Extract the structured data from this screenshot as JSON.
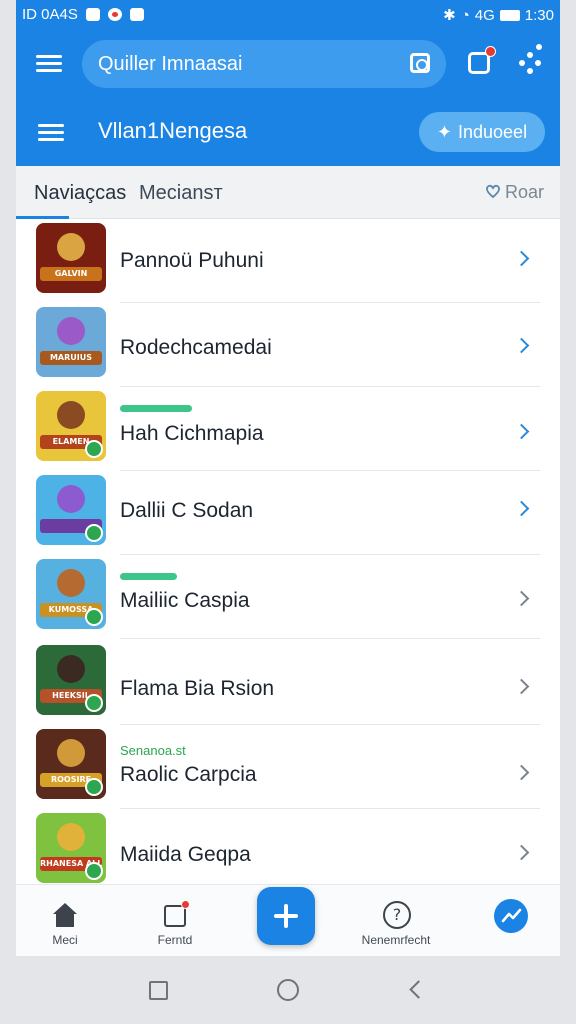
{
  "status_bar": {
    "time_left": "ID 0A4S",
    "time_right": "1:30",
    "signal_text": "4G"
  },
  "search": {
    "placeholder": "Quiller Imnaasai"
  },
  "header": {
    "title": "Vllan1Nengesa",
    "action_label": "Induoeel",
    "action_icon": "sparkle-icon"
  },
  "tabs": {
    "items": [
      "Naviaçcas",
      "Meciansт"
    ],
    "active": 0,
    "favorite_label": "Roar"
  },
  "list": [
    {
      "label": "Pannoü Puhuni",
      "thumb_text": "GALVIN",
      "bar": false,
      "sub": "",
      "chevron_color": "#2b8ad8",
      "thumb_bg": "#7a1e12",
      "face": "#d9a441",
      "banner": "#c8731c"
    },
    {
      "label": "Rodechcamedai",
      "thumb_text": "MARUIUS",
      "bar": false,
      "sub": "",
      "chevron_color": "#2b8ad8",
      "thumb_bg": "#6aa9d8",
      "face": "#9a5ac8",
      "banner": "#a8591e"
    },
    {
      "label": "Hah Cichmapia",
      "thumb_text": "ELAMEN",
      "bar": true,
      "sub": "",
      "chevron_color": "#2b8ad8",
      "thumb_bg": "#e8c53a",
      "face": "#8a4a22",
      "banner": "#b2431d"
    },
    {
      "label": "Dallii C Sodan",
      "thumb_text": "",
      "bar": false,
      "sub": "",
      "chevron_color": "#2b8ad8",
      "thumb_bg": "#4db2e6",
      "face": "#8c5bd0",
      "banner": "#6c3da0"
    },
    {
      "label": "Mailiic Caspia",
      "thumb_text": "KUMOSSA",
      "bar": true,
      "sub": "",
      "chevron_color": "#7a838c",
      "thumb_bg": "#57b1e0",
      "face": "#b56a32",
      "banner": "#c99022"
    },
    {
      "label": "Flama Bia Rsion",
      "thumb_text": "HEEKSIL",
      "bar": false,
      "sub": "",
      "chevron_color": "#7a838c",
      "thumb_bg": "#2d6a3a",
      "face": "#3a2a22",
      "banner": "#b5522a"
    },
    {
      "label": "Raolic Carpcia",
      "thumb_text": "ROOSIRE",
      "bar": false,
      "sub": "Senanoa.st",
      "chevron_color": "#7a838c",
      "thumb_bg": "#5a2a1c",
      "face": "#d09a3a",
      "banner": "#d6a127"
    },
    {
      "label": "Maiida Geqpa",
      "thumb_text": "RHANESA ALLANST",
      "bar": false,
      "sub": "",
      "chevron_color": "#7a838c",
      "thumb_bg": "#7fc23f",
      "face": "#e0b23a",
      "banner": "#c03a1c"
    }
  ],
  "bottom_nav": {
    "home_label": "Meci",
    "calendar_label": "Ferntd",
    "help_label": "Nenemrfecht",
    "fab_icon": "plus-icon"
  },
  "colors": {
    "primary": "#1a83e3",
    "accent_green": "#3ec58a"
  }
}
